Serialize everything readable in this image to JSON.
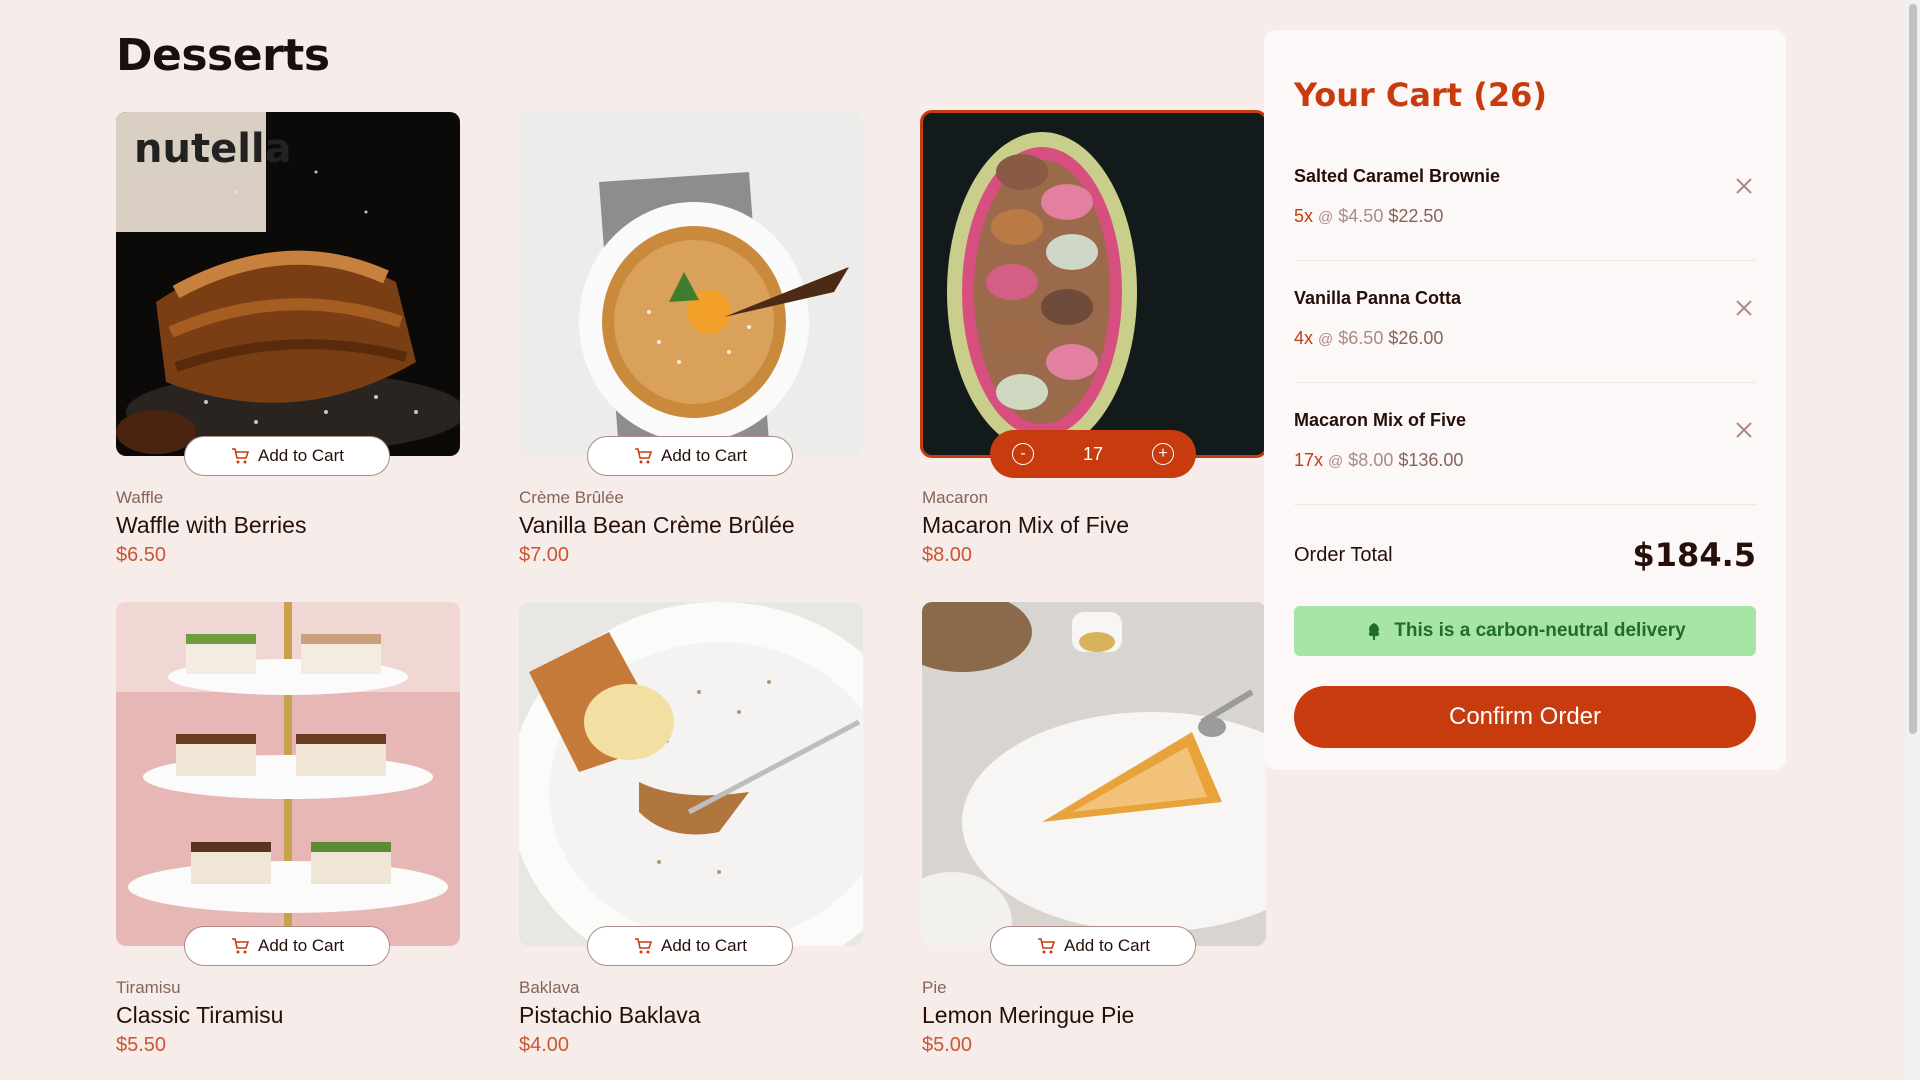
{
  "page": {
    "title": "Desserts"
  },
  "products": [
    {
      "category": "Waffle",
      "name": "Waffle with Berries",
      "price": "$6.50",
      "button": "Add to Cart"
    },
    {
      "category": "Crème Brûlée",
      "name": "Vanilla Bean Crème Brûlée",
      "price": "$7.00",
      "button": "Add to Cart"
    },
    {
      "category": "Macaron",
      "name": "Macaron Mix of Five",
      "price": "$8.00",
      "quantity": "17",
      "minus": "-",
      "plus": "+"
    },
    {
      "category": "Tiramisu",
      "name": "Classic Tiramisu",
      "price": "$5.50",
      "button": "Add to Cart"
    },
    {
      "category": "Baklava",
      "name": "Pistachio Baklava",
      "price": "$4.00",
      "button": "Add to Cart"
    },
    {
      "category": "Pie",
      "name": "Lemon Meringue Pie",
      "price": "$5.00",
      "button": "Add to Cart"
    }
  ],
  "cart": {
    "title": "Your Cart (26)",
    "items": [
      {
        "name": "Salted Caramel Brownie",
        "qty": "5x",
        "at": "@",
        "unit": "$4.50",
        "line": "$22.50"
      },
      {
        "name": "Vanilla Panna Cotta",
        "qty": "4x",
        "at": "@",
        "unit": "$6.50",
        "line": "$26.00"
      },
      {
        "name": "Macaron Mix of Five",
        "qty": "17x",
        "at": "@",
        "unit": "$8.00",
        "line": "$136.00"
      }
    ],
    "total_label": "Order Total",
    "total_value": "$184.5",
    "carbon_note": "This is a carbon-neutral delivery",
    "confirm_label": "Confirm Order"
  },
  "icons": {
    "cart": "cart-icon",
    "remove": "close-icon",
    "tree": "tree-icon"
  },
  "colors": {
    "accent": "#c73b0f",
    "background": "#f6ecea",
    "carbon_bg": "#a7e5a7",
    "carbon_text": "#1f6e23"
  }
}
